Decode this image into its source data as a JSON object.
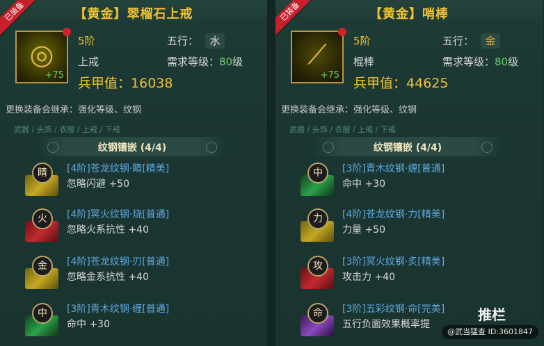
{
  "left": {
    "badge": "已装备",
    "title": "【黄金】翠榴石上戒",
    "plus": "+75",
    "tier": "5阶",
    "wuxing_label": "五行：",
    "wuxing": "水",
    "type": "上戒",
    "req_prefix": "需求等级：",
    "req_level": "80",
    "req_suffix": "级",
    "power_label": "兵甲值：",
    "power": "16038",
    "inherit": "更换装备会继承：强化等级、纹钢",
    "ghost": "武器 / 头饰 / 衣服 / 上戒 / 下戒",
    "socket_title": "纹钢镶嵌 (4/4)",
    "gems": [
      {
        "char": "睛",
        "color": "gold",
        "name": "[4阶]苍龙纹钢·睛[精美]",
        "stat": "忽略闪避   +50"
      },
      {
        "char": "火",
        "color": "red",
        "name": "[4阶]冥火纹钢·烧[普通]",
        "stat": "忽略火系抗性   +40"
      },
      {
        "char": "金",
        "color": "gold",
        "name": "[4阶]苍龙纹钢·刃[普通]",
        "stat": "忽略金系抗性   +40"
      },
      {
        "char": "中",
        "color": "green",
        "name": "[3阶]青木纹钢·缠[普通]",
        "stat": "命中   +30"
      }
    ]
  },
  "right": {
    "badge": "已装备",
    "title": "【黄金】哨棒",
    "plus": "+75",
    "tier": "5阶",
    "wuxing_label": "五行：",
    "wuxing": "金",
    "type": "棍棒",
    "req_prefix": "需求等级：",
    "req_level": "80",
    "req_suffix": "级",
    "power_label": "兵甲值：",
    "power": "44625",
    "inherit": "更换装备会继承：强化等级、纹钢",
    "ghost": "武器 / 头饰 / 衣服 / 上戒 / 下戒",
    "socket_title": "纹钢镶嵌 (4/4)",
    "gems": [
      {
        "char": "中",
        "color": "green",
        "name": "[3阶]青木纹钢·缠[普通]",
        "stat": "命中   +30"
      },
      {
        "char": "力",
        "color": "gold",
        "name": "[4阶]苍龙纹钢·力[精美]",
        "stat": "力量   +50"
      },
      {
        "char": "攻",
        "color": "red",
        "name": "[3阶]冥火纹钢·炙[精美]",
        "stat": "攻击力   +40"
      },
      {
        "char": "命",
        "color": "purple",
        "name": "[3阶]五彩纹钢·命[完美]",
        "stat": "五行负面效果概率提"
      }
    ]
  },
  "watermark": {
    "big": "推栏",
    "small": "@武当猛查  ID:3601847"
  }
}
